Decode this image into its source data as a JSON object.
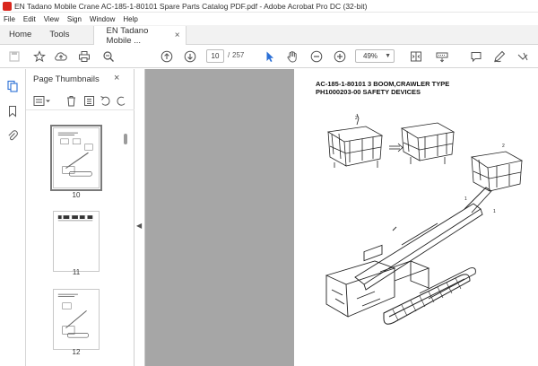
{
  "window": {
    "title": "EN Tadano Mobile Crane AC-185-1-80101 Spare Parts Catalog PDF.pdf - Adobe Acrobat Pro DC (32-bit)"
  },
  "menu": [
    "File",
    "Edit",
    "View",
    "Sign",
    "Window",
    "Help"
  ],
  "tabs": {
    "home": "Home",
    "tools": "Tools",
    "document": "EN Tadano Mobile ...",
    "close": "×"
  },
  "toolbar": {
    "icons": [
      "save-icon",
      "star-icon",
      "upload-icon",
      "print-icon",
      "search-icon",
      "prev-page-icon",
      "next-page-icon",
      "select-icon",
      "hand-icon",
      "zoom-out-icon",
      "zoom-in-icon",
      "fit-icon",
      "keyboard-icon",
      "comment-icon",
      "pen-icon",
      "more-icon"
    ],
    "current_page": "10",
    "page_separator": "/",
    "total_pages": "257",
    "zoom": "49%",
    "zoom_arrow": "▼"
  },
  "thumbnails_panel": {
    "title": "Page Thumbnails",
    "close": "×",
    "thumbnails": [
      {
        "label": "10",
        "selected": true
      },
      {
        "label": "11",
        "selected": false
      },
      {
        "label": "12",
        "selected": false
      }
    ]
  },
  "collapse_arrow": "◀",
  "document_page": {
    "heading_line1": "AC-185-1-80101 3 BOOM,CRAWLER TYPE",
    "heading_line2": "PH1000203-00 SAFETY DEVICES",
    "callouts": [
      "2",
      "2",
      "1",
      "1"
    ]
  }
}
